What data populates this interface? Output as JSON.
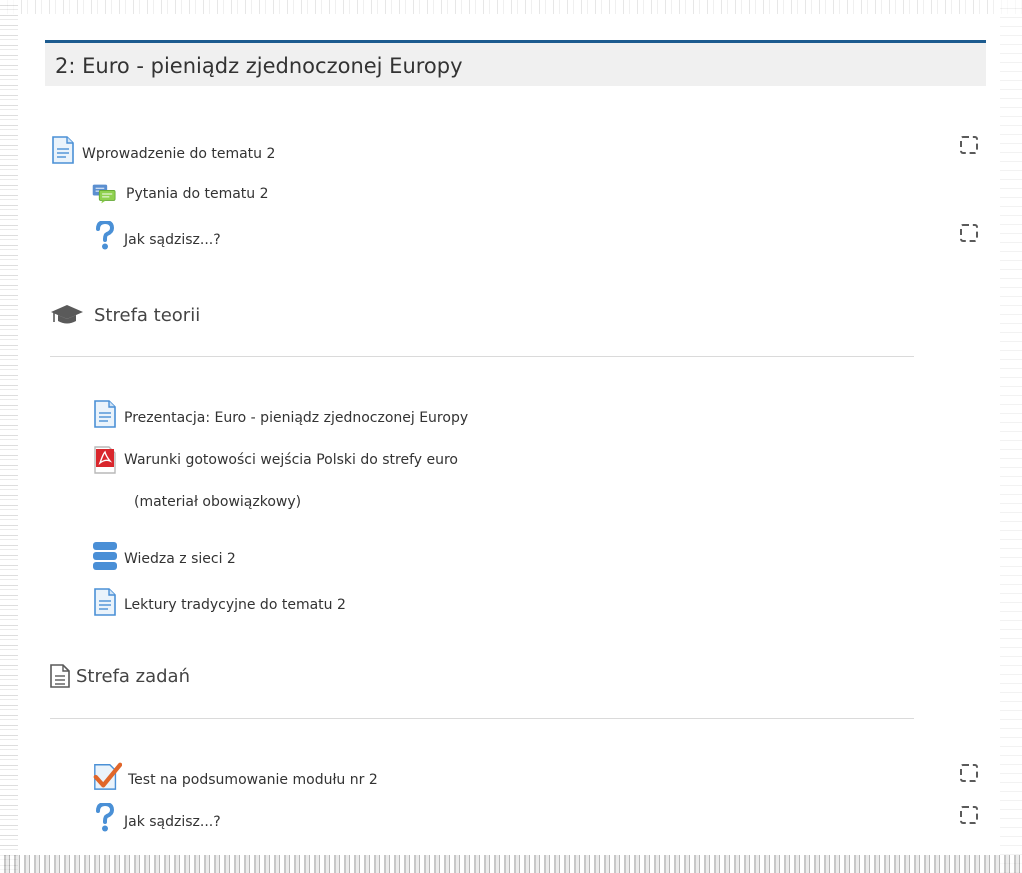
{
  "section": {
    "title": "2: Euro - pieniądz zjednoczonej Europy",
    "accent_color": "#1c5b8f"
  },
  "intro_items": [
    {
      "label": "Wprowadzenie do tematu 2",
      "icon": "page-icon",
      "has_completion": true
    },
    {
      "label": "Pytania do tematu 2",
      "icon": "forum-icon",
      "has_completion": false
    },
    {
      "label": "Jak sądzisz...?",
      "icon": "question-icon",
      "has_completion": true
    }
  ],
  "theory_zone": {
    "heading": "Strefa teorii",
    "icon": "graduation-cap-icon",
    "items": [
      {
        "label": "Prezentacja: Euro - pieniądz zjednoczonej Europy",
        "icon": "page-icon"
      },
      {
        "label": "Warunki gotowości wejścia Polski do strefy euro",
        "label_line2": "(materiał obowiązkowy)",
        "icon": "pdf-icon"
      },
      {
        "label": "Wiedza z sieci 2",
        "icon": "database-icon"
      },
      {
        "label": "Lektury tradycyjne do tematu 2",
        "icon": "page-icon"
      }
    ]
  },
  "tasks_zone": {
    "heading": "Strefa zadań",
    "icon": "document-icon",
    "items": [
      {
        "label": "Test na podsumowanie modułu nr 2",
        "icon": "quiz-icon",
        "has_completion": true
      },
      {
        "label": "Jak sądzisz...?",
        "icon": "question-icon",
        "has_completion": true
      }
    ]
  }
}
